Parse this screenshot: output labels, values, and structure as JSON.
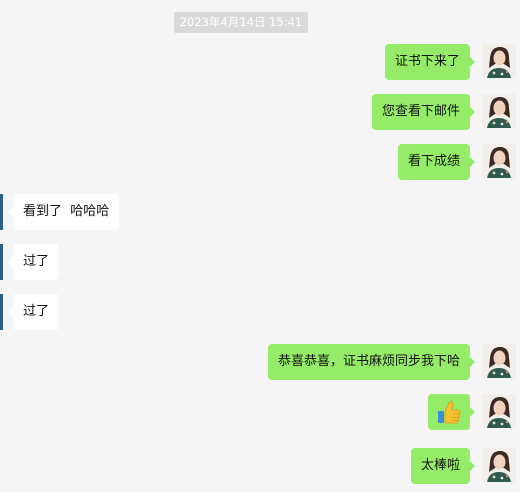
{
  "timestamp": "2023年4月14日 15:41",
  "messages": [
    {
      "side": "out",
      "text": "证书下来了"
    },
    {
      "side": "out",
      "text": "您查看下邮件"
    },
    {
      "side": "out",
      "text": "看下成绩"
    },
    {
      "side": "in",
      "text": "看到了  哈哈哈"
    },
    {
      "side": "in",
      "text": "过了"
    },
    {
      "side": "in",
      "text": "过了"
    },
    {
      "side": "out",
      "text": "恭喜恭喜，证书麻烦同步我下哈"
    },
    {
      "side": "out",
      "icon": "thumbs-up-icon"
    },
    {
      "side": "out",
      "text": "太棒啦"
    }
  ],
  "colors": {
    "background": "#f5f5f5",
    "outgoing_bubble": "#95ec69",
    "incoming_bubble": "#ffffff",
    "timestamp_bg": "#dadada"
  }
}
